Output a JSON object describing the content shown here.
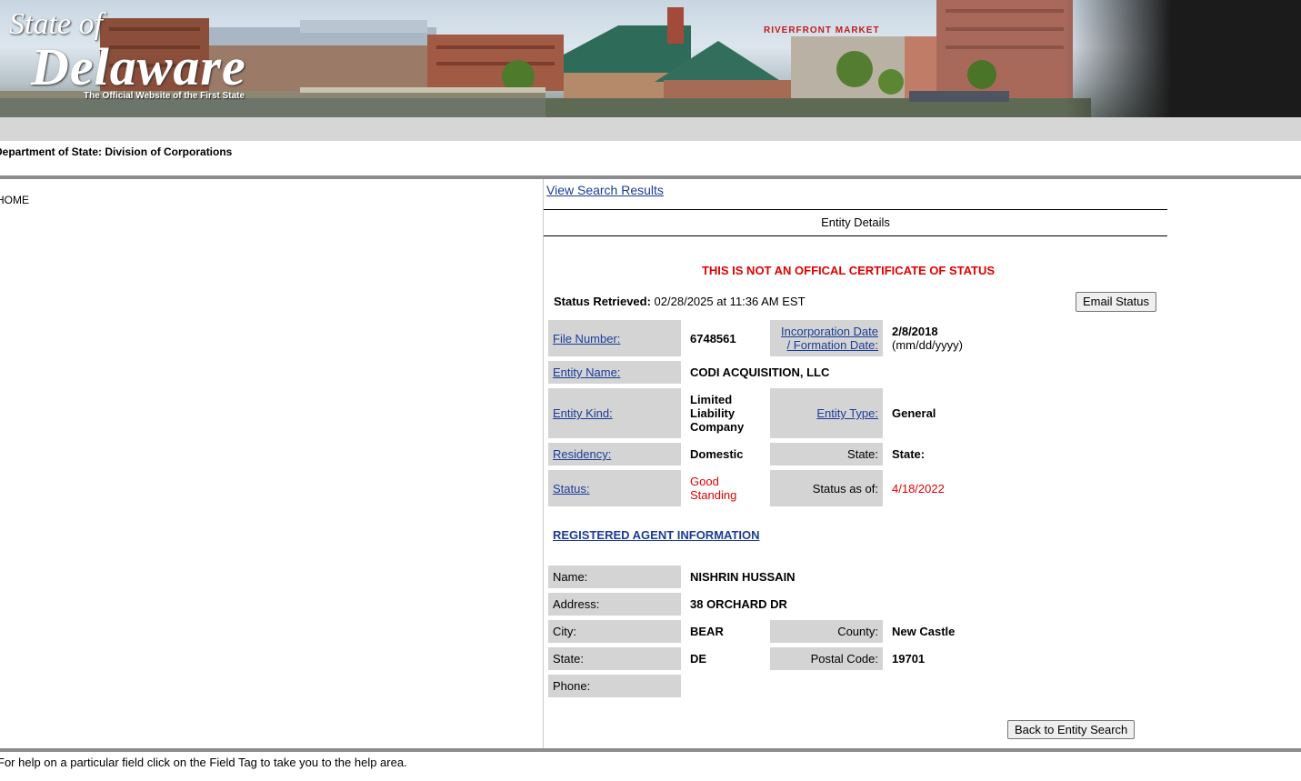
{
  "banner": {
    "state_of": "State of",
    "delaware": "Delaware",
    "subtitle": "The Official Website of the First State",
    "sign": "RIVERFRONT MARKET"
  },
  "header": {
    "department": "Department of State: Division of Corporations",
    "home": "HOME"
  },
  "nav": {
    "view_results": "View Search Results",
    "entity_details": "Entity Details"
  },
  "notice": "THIS IS NOT AN OFFICAL CERTIFICATE OF STATUS",
  "status_retrieved": {
    "label": "Status Retrieved:",
    "value": "02/28/2025 at 11:36 AM EST"
  },
  "buttons": {
    "email_status": "Email Status",
    "back_to_search": "Back to Entity Search"
  },
  "entity": {
    "file_number_label": "File Number:",
    "file_number": "6748561",
    "inc_date_label_1": "Incorporation Date",
    "inc_date_label_2": "/ Formation Date:",
    "inc_date": "2/8/2018",
    "inc_date_format": "(mm/dd/yyyy)",
    "name_label": "Entity Name:",
    "name": "CODI ACQUISITION, LLC",
    "kind_label": "Entity Kind:",
    "kind": "Limited Liability Company",
    "type_label": "Entity Type:",
    "type": "General",
    "residency_label": "Residency:",
    "residency": "Domestic",
    "state_label": "State:",
    "state": "State:",
    "status_label": "Status:",
    "status": "Good Standing",
    "status_as_of_label": "Status as of:",
    "status_as_of": "4/18/2022"
  },
  "agent": {
    "heading": "REGISTERED AGENT INFORMATION",
    "name_label": "Name:",
    "name": "NISHRIN HUSSAIN",
    "address_label": "Address:",
    "address": "38 ORCHARD DR",
    "city_label": "City:",
    "city": "BEAR",
    "county_label": "County:",
    "county": "New Castle",
    "state_label": "State:",
    "state": "DE",
    "postal_label": "Postal Code:",
    "postal": "19701",
    "phone_label": "Phone:",
    "phone": ""
  },
  "footer": {
    "help": "For help on a particular field click on the Field Tag to take you to the help area."
  },
  "colors": {
    "link": "#1a3c96",
    "alert": "#e00000",
    "label_bg": "#d4d4d4",
    "rule": "#8c8c8c"
  }
}
